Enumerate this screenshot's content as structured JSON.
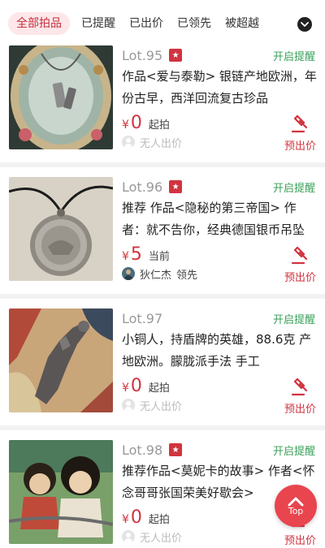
{
  "tabs": [
    {
      "label": "全部拍品",
      "active": true
    },
    {
      "label": "已提醒",
      "active": false
    },
    {
      "label": "已出价",
      "active": false
    },
    {
      "label": "已领先",
      "active": false
    },
    {
      "label": "被超越",
      "active": false
    }
  ],
  "tab_dropdown_icon": "chevron-down-icon",
  "lots": [
    {
      "lot": "Lot.95",
      "remind": "开启提醒",
      "title": "作品<爱与泰勒> 银链产地欧洲，年份古早，西洋回流复古珍品",
      "currency": "¥",
      "price": "0",
      "price_status": "起拍",
      "bidder": "无人出价",
      "bidder_lead": "",
      "bid_label": "预出价"
    },
    {
      "lot": "Lot.96",
      "remind": "开启提醒",
      "title": "推荐 作品<隐秘的第三帝国> 作者：就不告你，经典德国银币吊坠",
      "currency": "¥",
      "price": "5",
      "price_status": "当前",
      "bidder": "狄仁杰",
      "bidder_lead": "领先",
      "bid_label": "预出价"
    },
    {
      "lot": "Lot.97",
      "remind": "开启提醒",
      "title": "小铜人，持盾牌的英雄，88.6克 产地欧洲。朦胧派手法 手工",
      "currency": "¥",
      "price": "0",
      "price_status": "起拍",
      "bidder": "无人出价",
      "bidder_lead": "",
      "bid_label": "预出价"
    },
    {
      "lot": "Lot.98",
      "remind": "开启提醒",
      "title": "推荐作品<莫妮卡的故事> 作者<怀念哥哥张国荣美好歇会>",
      "currency": "¥",
      "price": "0",
      "price_status": "起拍",
      "bidder": "无人出价",
      "bidder_lead": "",
      "bid_label": "预出价"
    }
  ],
  "top_button": {
    "label": "Top",
    "icon": "chevron-up-icon"
  },
  "colors": {
    "accent": "#d0343f",
    "remind": "#3aa05a",
    "active_tab_bg": "#fde7ea",
    "top_button": "#e8454f"
  }
}
